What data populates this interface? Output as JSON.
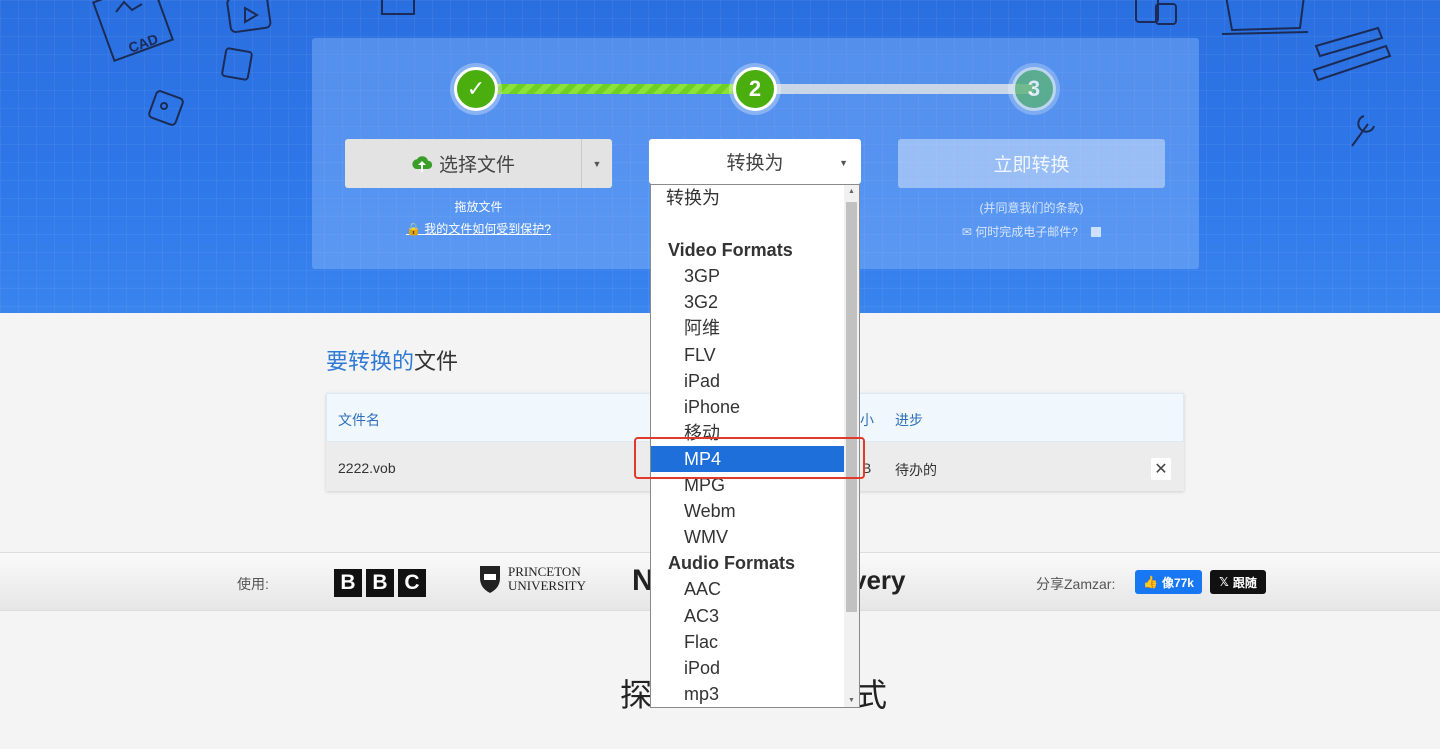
{
  "stepper": {
    "step1_icon": "check-icon",
    "step1_glyph": "✓",
    "step2_label": "2",
    "step3_label": "3"
  },
  "upload": {
    "choose_label": "选择文件",
    "drop_label": "拖放文件",
    "protect_link": "我的文件如何受到保护?"
  },
  "convert": {
    "select_label": "转换为",
    "convert_now_label": "立即转换",
    "agree_text": "(并同意我们的条款)",
    "email_text": "何时完成电子邮件?"
  },
  "files": {
    "title_accent": "要转换的",
    "title_rest": "文件",
    "col_name": "文件名",
    "col_size": "小",
    "col_progress": "进步",
    "row_name": "2222.vob",
    "row_size": "B",
    "row_status": "待办的",
    "remove_glyph": "✕"
  },
  "logos": {
    "used_by": "使用:",
    "bbc": [
      "B",
      "B",
      "C"
    ],
    "princeton_line1": "PRINCETON",
    "princeton_line2": "UNIVERSITY",
    "nat_partial": "N",
    "disc_partial": "very",
    "share_label": "分享Zamzar:",
    "fb_label": "像77k",
    "x_label": "跟随"
  },
  "explore": {
    "head": "探",
    "tail": "式"
  },
  "dropdown": {
    "items": [
      {
        "label": "转换为",
        "type": "placeholder"
      },
      {
        "label": "",
        "type": "spacer"
      },
      {
        "label": "Video Formats",
        "type": "group"
      },
      {
        "label": "3GP",
        "type": "option"
      },
      {
        "label": "3G2",
        "type": "option"
      },
      {
        "label": "阿维",
        "type": "option"
      },
      {
        "label": "FLV",
        "type": "option"
      },
      {
        "label": "iPad",
        "type": "option"
      },
      {
        "label": "iPhone",
        "type": "option"
      },
      {
        "label": "移动",
        "type": "option"
      },
      {
        "label": "MP4",
        "type": "option",
        "selected": true
      },
      {
        "label": "MPG",
        "type": "option"
      },
      {
        "label": "Webm",
        "type": "option"
      },
      {
        "label": "WMV",
        "type": "option"
      },
      {
        "label": "Audio Formats",
        "type": "group"
      },
      {
        "label": "AAC",
        "type": "option"
      },
      {
        "label": "AC3",
        "type": "option"
      },
      {
        "label": "Flac",
        "type": "option"
      },
      {
        "label": "iPod",
        "type": "option"
      },
      {
        "label": "mp3",
        "type": "option"
      }
    ]
  },
  "colors": {
    "hero_blue": "#2f78ea",
    "step_green": "#4aae0e",
    "selected_blue": "#1e6fd9",
    "annotation_red": "#e03a2a"
  }
}
